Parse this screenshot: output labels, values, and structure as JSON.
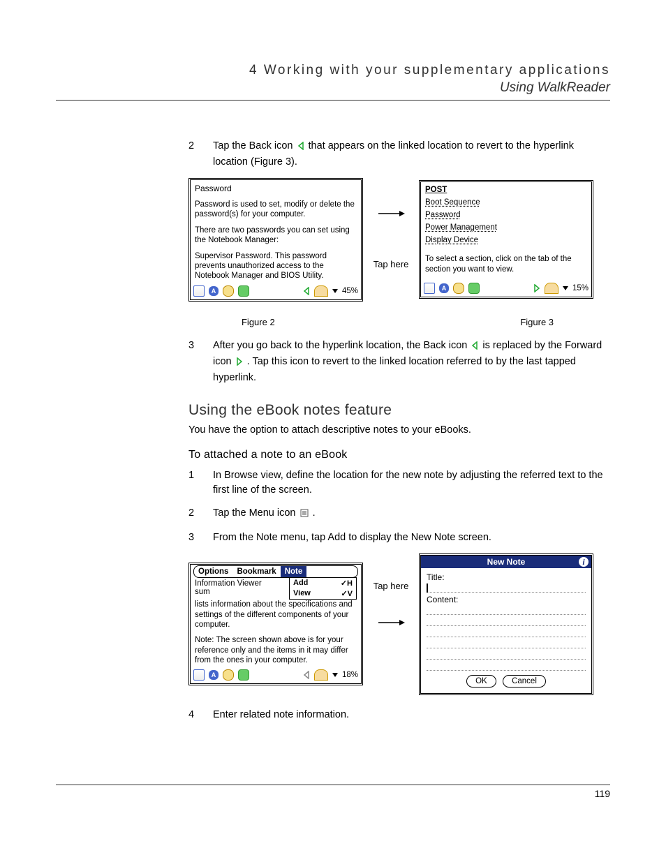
{
  "header": {
    "chapter": "4 Working with your supplementary applications",
    "section": "Using WalkReader"
  },
  "step2": {
    "num": "2",
    "text_a": "Tap the Back icon ",
    "text_b": " that appears on the linked location to revert to the hyperlink location (Figure 3)."
  },
  "fig2": {
    "title": "Password",
    "p1": "Password is used to set, modify or delete the password(s) for your computer.",
    "p2": "There are two passwords you can set using the Notebook Manager:",
    "p3": "Supervisor Password. This password prevents unauthorized access to the Notebook Manager and BIOS Utility.",
    "progress": "45%",
    "caption": "Figure 2"
  },
  "tap_here": "Tap here",
  "fig3": {
    "l1": "POST",
    "l2": "Boot Sequence",
    "l3": "Password",
    "l4": "Power Management",
    "l5": "Display Device",
    "p1": "To select a section, click on the tab of the section you want to view.",
    "progress": "15%",
    "caption": "Figure 3"
  },
  "step3": {
    "num": "3",
    "text_a": "After you go back to the hyperlink location, the Back icon ",
    "text_b": " is replaced by the Forward icon ",
    "text_c": ". Tap this icon to revert to the linked location referred to by the last tapped hyperlink."
  },
  "h2": "Using the eBook notes feature",
  "h2_desc": "You have the option to attach descriptive notes to your eBooks.",
  "h3": "To attached a note to an eBook",
  "stepN1": {
    "num": "1",
    "text": "In Browse view, define the location for the new note by adjusting the referred text to the first line of the screen."
  },
  "stepN2": {
    "num": "2",
    "text_a": "Tap the Menu icon ",
    "text_b": "."
  },
  "stepN3": {
    "num": "3",
    "text": "From the Note menu, tap Add to display the New Note screen."
  },
  "figMenu": {
    "m1": "Options",
    "m2": "Bookmark",
    "m3": "Note",
    "dd_add": "Add",
    "dd_add_sc": "✓H",
    "dd_view": "View",
    "dd_view_sc": "✓V",
    "before": "Information Viewer sum",
    "p1": "lists information about the specifications and settings of the different components of your computer.",
    "p2": "Note: The screen shown above is for your reference only and the items in it may differ from the ones in your computer.",
    "progress": "18%"
  },
  "dialog": {
    "title": "New Note",
    "field_title": "Title:",
    "field_content": "Content:",
    "ok": "OK",
    "cancel": "Cancel"
  },
  "stepN4": {
    "num": "4",
    "text": "Enter related note information."
  },
  "page_num": "119"
}
